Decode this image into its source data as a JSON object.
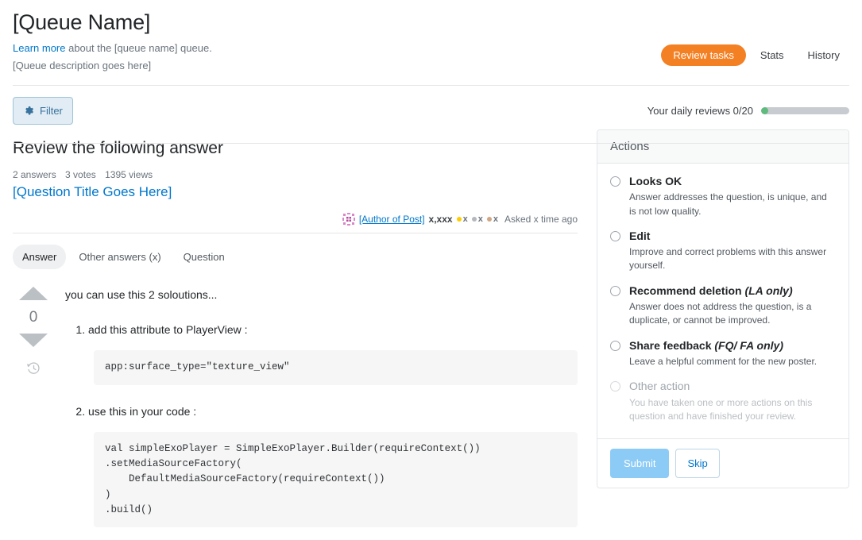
{
  "header": {
    "title": "[Queue Name]",
    "learn_more_link": "Learn more",
    "subtitle_rest": " about the [queue name] queue.",
    "description": "[Queue description goes here]",
    "nav": {
      "review_tasks": "Review tasks",
      "stats": "Stats",
      "history": "History"
    },
    "accent_color": "#f48024"
  },
  "filter_bar": {
    "filter_label": "Filter",
    "filter_icon": "gear-icon",
    "daily_reviews_label": "Your daily reviews 0/20",
    "daily_reviews_done": 0,
    "daily_reviews_total": 20,
    "progress_color": "#5eba7d",
    "track_color": "#c8ccd0"
  },
  "review": {
    "heading": "Review the following answer",
    "stats": {
      "answers": "2 answers",
      "votes": "3 votes",
      "views": "1395 views"
    },
    "question_title": "[Question Title Goes Here]",
    "byline": {
      "avatar_icon": "identicon-avatar",
      "author": "[Author of Post]",
      "reputation": "x,xxx",
      "gold_count": "x",
      "silver_count": "x",
      "bronze_count": "x",
      "gold_color": "#ffcc01",
      "silver_color": "#b4b8bc",
      "bronze_color": "#d1a684",
      "time": "Asked x time ago"
    },
    "tabs": [
      {
        "label": "Answer",
        "active": true
      },
      {
        "label": "Other answers (x)",
        "active": false
      },
      {
        "label": "Question",
        "active": false
      }
    ],
    "vote": {
      "up_icon": "arrow-up-icon",
      "score": "0",
      "down_icon": "arrow-down-icon",
      "history_icon": "revision-history-icon"
    },
    "answer": {
      "intro": "you can use this 2 soloutions...",
      "step1": "add this attribute to PlayerView :",
      "code1": "app:surface_type=\"texture_view\"",
      "step2": "use this in your code :",
      "code2": "val simpleExoPlayer = SimpleExoPlayer.Builder(requireContext())\n.setMediaSourceFactory(\n    DefaultMediaSourceFactory(requireContext())\n)\n.build()"
    }
  },
  "actions": {
    "title": "Actions",
    "options": [
      {
        "label": "Looks OK",
        "suffix": "",
        "desc": "Answer addresses the question, is unique, and is not low quality.",
        "disabled": false
      },
      {
        "label": "Edit",
        "suffix": "",
        "desc": "Improve and correct problems with this answer yourself.",
        "disabled": false
      },
      {
        "label": "Recommend deletion ",
        "suffix": "(LA only)",
        "desc": "Answer does not address the question, is a duplicate, or cannot be improved.",
        "disabled": false
      },
      {
        "label": "Share feedback ",
        "suffix": "(FQ/ FA only)",
        "desc": "Leave a helpful comment for the new poster.",
        "disabled": false
      },
      {
        "label": "Other action",
        "suffix": "",
        "desc": "You have taken one or more actions on this question and have finished your review.",
        "disabled": true
      }
    ],
    "submit_label": "Submit",
    "skip_label": "Skip"
  }
}
